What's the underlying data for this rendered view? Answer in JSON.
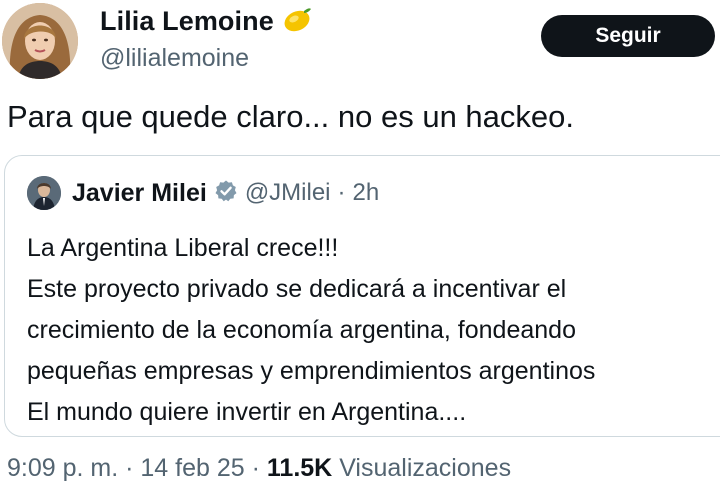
{
  "author": {
    "name": "Lilia Lemoine",
    "name_emoji": "lemon-emoji",
    "handle": "@lilialemoine"
  },
  "follow_button": {
    "label": "Seguir"
  },
  "tweet": {
    "text": "Para que quede claro... no es un hackeo."
  },
  "quote": {
    "name": "Javier Milei",
    "badge": "verified-badge-icon",
    "handle": "@JMilei",
    "separator": "·",
    "time": "2h",
    "lines": [
      "La Argentina Liberal crece!!!",
      "Este proyecto privado se dedicará a incentivar el",
      "crecimiento de la economía argentina, fondeando",
      "pequeñas empresas y emprendimientos argentinos",
      "El mundo quiere invertir en Argentina...."
    ]
  },
  "meta": {
    "time": "9:09 p. m.",
    "sep1": "·",
    "date": "14 feb 25",
    "sep2": "·",
    "views_count": "11.5K",
    "views_label": "Visualizaciones"
  },
  "colors": {
    "text": "#0f1419",
    "secondary": "#536471",
    "border": "#cfd9de",
    "button_bg": "#0f1419",
    "button_text": "#ffffff",
    "verified_badge": "#829aab",
    "lemon": "#f5c400"
  }
}
